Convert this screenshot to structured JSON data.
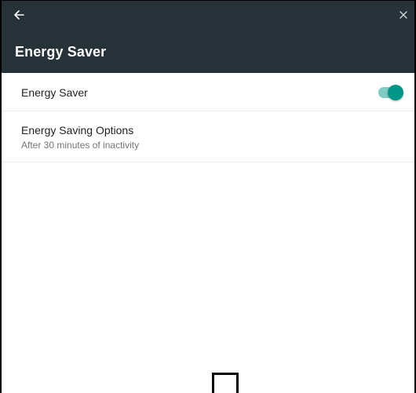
{
  "app_bar": {
    "title": "Energy Saver",
    "background_color": "#263238",
    "back_icon": "arrow-left-icon",
    "close_icon": "close-icon"
  },
  "settings": {
    "energy_saver": {
      "label": "Energy Saver",
      "enabled": true,
      "accent_color": "#009688"
    },
    "options": {
      "label": "Energy Saving Options",
      "summary": "After 30 minutes of inactivity"
    }
  }
}
